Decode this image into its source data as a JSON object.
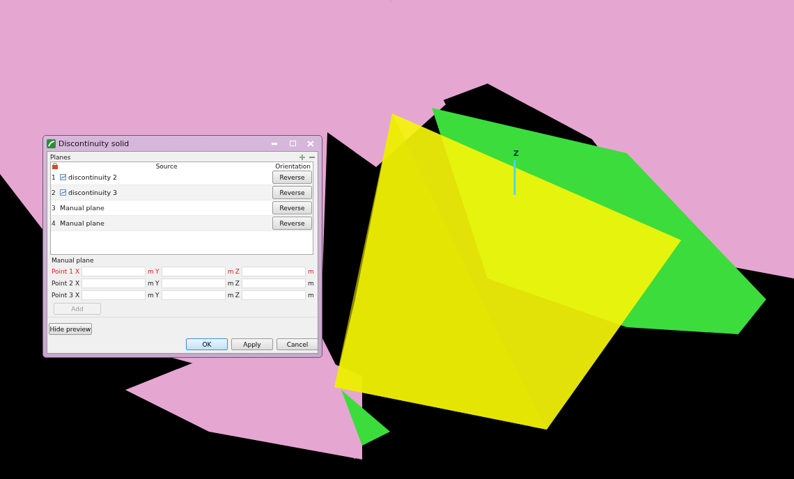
{
  "scene": {
    "axis_label": "Z"
  },
  "window": {
    "title": "Discontinuity solid"
  },
  "planes": {
    "title": "Planes",
    "columns": [
      "Source",
      "Orientation"
    ],
    "rows": [
      {
        "index": "1",
        "kind": "linked",
        "source": "discontinuity 2",
        "button": "Reverse"
      },
      {
        "index": "2",
        "kind": "linked",
        "source": "discontinuity 3",
        "button": "Reverse"
      },
      {
        "index": "3",
        "kind": "manual",
        "source": "Manual plane",
        "button": "Reverse"
      },
      {
        "index": "4",
        "kind": "manual",
        "source": "Manual plane",
        "button": "Reverse"
      }
    ]
  },
  "manual_plane": {
    "title": "Manual plane",
    "points": [
      {
        "label": "Point 1",
        "active": true,
        "x": "X",
        "y": "Y",
        "z": "Z",
        "unit_x": "m",
        "unit_y": "m",
        "unit_z": "m"
      },
      {
        "label": "Point 2",
        "active": false,
        "x": "X",
        "y": "Y",
        "z": "Z",
        "unit_x": "m",
        "unit_y": "m",
        "unit_z": "m"
      },
      {
        "label": "Point 3",
        "active": false,
        "x": "X",
        "y": "Y",
        "z": "Z",
        "unit_x": "m",
        "unit_y": "m",
        "unit_z": "m"
      }
    ],
    "add_button": {
      "label": "Add",
      "disabled": true
    }
  },
  "preview_button": "Hide preview",
  "buttons": [
    {
      "label": "OK",
      "selected": true
    },
    {
      "label": "Apply",
      "selected": false
    },
    {
      "label": "Cancel",
      "selected": false
    }
  ]
}
